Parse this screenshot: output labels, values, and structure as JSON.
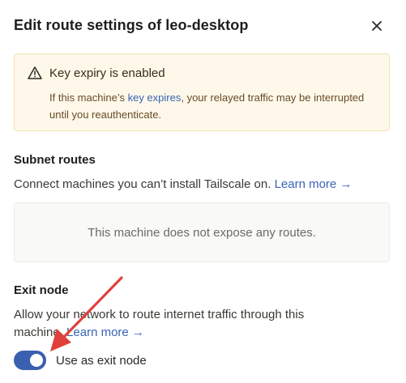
{
  "dialog": {
    "title": "Edit route settings of leo-desktop",
    "close_icon": "close-icon"
  },
  "alert": {
    "icon": "warning-icon",
    "title": "Key expiry is enabled",
    "body_prefix": "If this machine’s ",
    "body_link": "key expires",
    "body_suffix": ", your relayed traffic may be interrupted until you reauthenticate."
  },
  "subnet_routes": {
    "title": "Subnet routes",
    "description": "Connect machines you can’t install Tailscale on. ",
    "learn_more": "Learn more →",
    "empty_message": "This machine does not expose any routes."
  },
  "exit_node": {
    "title": "Exit node",
    "description": "Allow your network to route internet traffic through this machine. ",
    "learn_more": "Learn more →",
    "toggle_label": "Use as exit node",
    "toggle_on": true
  },
  "colors": {
    "accent": "#3b5fb1",
    "link": "#3a62b8",
    "alert_bg": "#fdf8e9",
    "alert_border": "#f4e3b2",
    "annotation_arrow": "#e0403a"
  }
}
